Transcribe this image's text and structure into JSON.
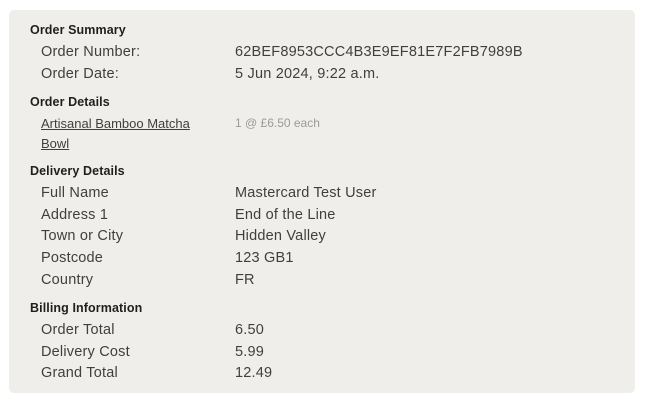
{
  "order_summary": {
    "title": "Order Summary",
    "rows": [
      {
        "label": "Order Number:",
        "value": "62BEF8953CCC4B3E9EF81E7F2FB7989B"
      },
      {
        "label": "Order Date:",
        "value": "5 Jun 2024, 9:22 a.m."
      }
    ]
  },
  "order_details": {
    "title": "Order Details",
    "items": [
      {
        "name": "Artisanal Bamboo Matcha Bowl",
        "quantity_price": "1 @ £6.50 each"
      }
    ]
  },
  "delivery_details": {
    "title": "Delivery Details",
    "rows": [
      {
        "label": "Full Name",
        "value": "Mastercard Test User"
      },
      {
        "label": "Address 1",
        "value": "End of the Line"
      },
      {
        "label": "Town or City",
        "value": "Hidden Valley"
      },
      {
        "label": "Postcode",
        "value": "123 GB1"
      },
      {
        "label": "Country",
        "value": "FR"
      }
    ]
  },
  "billing_information": {
    "title": "Billing Information",
    "rows": [
      {
        "label": "Order Total",
        "value": "6.50"
      },
      {
        "label": "Delivery Cost",
        "value": "5.99"
      },
      {
        "label": "Grand Total",
        "value": "12.49"
      }
    ]
  }
}
